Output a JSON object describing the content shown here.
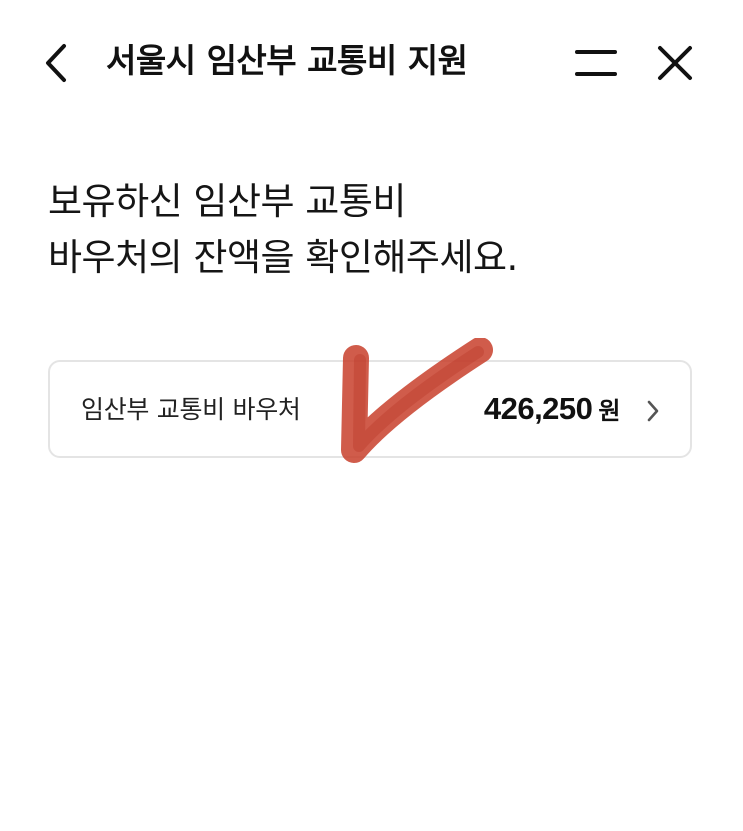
{
  "header": {
    "title": "서울시 임산부 교통비 지원",
    "back_icon": "chevron-left-icon",
    "menu_icon": "menu-icon",
    "close_icon": "close-icon"
  },
  "main": {
    "headline_line1": "보유하신 임산부 교통비",
    "headline_line2": "바우처의 잔액을 확인해주세요."
  },
  "voucher": {
    "label": "임산부 교통비 바우처",
    "amount": "426,250",
    "unit": "원",
    "chevron_icon": "chevron-right-icon"
  },
  "annotation": {
    "icon": "red-check-mark",
    "color": "#c8402c"
  }
}
